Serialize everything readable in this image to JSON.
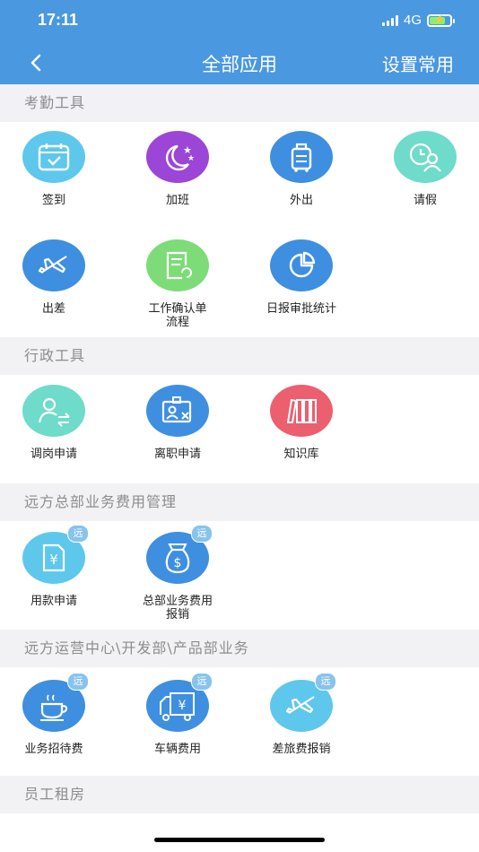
{
  "status": {
    "time": "17:11",
    "network": "4G"
  },
  "header": {
    "title": "全部应用",
    "right_action": "设置常用"
  },
  "sections": [
    {
      "title": "考勤工具",
      "apps": [
        {
          "label": "签到",
          "icon": "calendar-check-icon",
          "color": "#5ec7ec"
        },
        {
          "label": "加班",
          "icon": "moon-stars-icon",
          "color": "#9b46d6"
        },
        {
          "label": "外出",
          "icon": "luggage-icon",
          "color": "#3f8fe0"
        },
        {
          "label": "请假",
          "icon": "clock-person-icon",
          "color": "#6fdbca"
        },
        {
          "label": "出差",
          "icon": "airplane-icon",
          "color": "#3f8fe0"
        },
        {
          "label": "工作确认单\n流程",
          "icon": "document-sync-icon",
          "color": "#7ddc78"
        },
        {
          "label": "日报审批统计",
          "icon": "pie-chart-icon",
          "color": "#3f8fe0"
        }
      ]
    },
    {
      "title": "行政工具",
      "apps": [
        {
          "label": "调岗申请",
          "icon": "person-transfer-icon",
          "color": "#6fdbca"
        },
        {
          "label": "离职申请",
          "icon": "id-card-cancel-icon",
          "color": "#3f8fe0"
        },
        {
          "label": "知识库",
          "icon": "books-icon",
          "color": "#ec5f6e"
        }
      ]
    },
    {
      "title": "远方总部业务费用管理",
      "apps": [
        {
          "label": "用款申请",
          "icon": "yen-document-icon",
          "color": "#5ec7ec",
          "badge": "远"
        },
        {
          "label": "总部业务费用\n报销",
          "icon": "money-bag-icon",
          "color": "#3f8fe0",
          "badge": "远"
        }
      ]
    },
    {
      "title": "远方运营中心\\开发部\\产品部业务",
      "apps": [
        {
          "label": "业务招待费",
          "icon": "coffee-cup-icon",
          "color": "#3f8fe0",
          "badge": "远"
        },
        {
          "label": "车辆费用",
          "icon": "truck-yen-icon",
          "color": "#3f8fe0",
          "badge": "远"
        },
        {
          "label": "差旅费报销",
          "icon": "airplane-icon",
          "color": "#5ec7ec",
          "badge": "远"
        }
      ]
    },
    {
      "title": "员工租房",
      "apps": []
    }
  ]
}
